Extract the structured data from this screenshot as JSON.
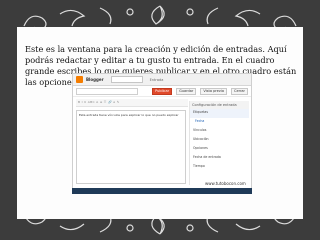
{
  "caption": "Este es la ventana para la creación y edición de entradas. Aquí podrás redactar y editar a tu gusto tu entrada. En el cuadro grande escribes lo que quieres publicar y en el otro cuadro están las opciones de configuración para las entradas.",
  "screenshot": {
    "brand": "Blogger",
    "post_title_label": "Entrada",
    "buttons": [
      "Publicar",
      "Guardar",
      "Vista previa",
      "Cerrar"
    ],
    "toolbar": "B I U ABC A ≡ ☷ 🔗 ⌂ ✎",
    "editor_text": "Esta entrada tiene vínculos para explicar lo que no puedo explicar",
    "sidebar": {
      "title": "Configuración de entrada",
      "items": [
        "Etiquetas",
        "Fecha",
        "Vínculos",
        "Ubicación",
        "Opciones",
        "Fecha de entrada",
        "Tiempo"
      ]
    },
    "url": "www.tutobocon.com"
  },
  "colors": {
    "background": "#3c3c3c",
    "panel": "#fdfdfd",
    "publish": "#e0492b"
  },
  "icons": [
    "swirl-ornament-icon"
  ]
}
